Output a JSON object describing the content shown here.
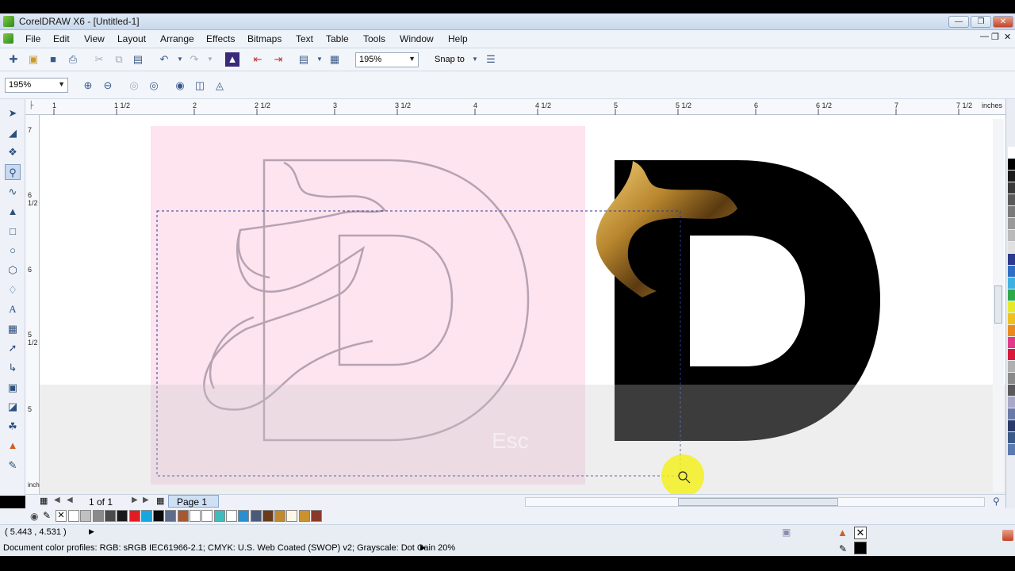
{
  "window": {
    "title": "CorelDRAW X6 - [Untitled-1]"
  },
  "menu": [
    "File",
    "Edit",
    "View",
    "Layout",
    "Arrange",
    "Effects",
    "Bitmaps",
    "Text",
    "Table",
    "Tools",
    "Window",
    "Help"
  ],
  "toolbar": {
    "zoom_value": "195%",
    "snap_label": "Snap to"
  },
  "toolbar2": {
    "zoom_value": "195%"
  },
  "ruler": {
    "h_labels": [
      "1",
      "1 1/2",
      "2",
      "2 1/2",
      "3",
      "3 1/2",
      "4",
      "4 1/2",
      "5",
      "5 1/2",
      "6",
      "6 1/2",
      "7",
      "7 1/2",
      "inches"
    ],
    "v_labels": [
      "7",
      "6 1/2",
      "6",
      "5 1/2",
      "5",
      "inches"
    ]
  },
  "pagebar": {
    "page_count": "1 of 1",
    "page_tab": "Page 1"
  },
  "status": {
    "coords": "( 5.443 , 4.531 )",
    "color_profile": "Document color profiles: RGB: sRGB IEC61966-2.1; CMYK: U.S. Web Coated (SWOP) v2; Grayscale: Dot Gain 20%"
  },
  "canvas": {
    "watermark_key": "Esc"
  },
  "colors": {
    "accent": "#3b5a88",
    "pink_bg": "#fde4ef",
    "outline": "#b7a2b1",
    "logo_fill": "#000000",
    "gold": "#b8862e"
  },
  "doc_palette": [
    "#ffffff",
    "#c0c0c0",
    "#8a8a8a",
    "#4a4a4a",
    "#1a1a1a",
    "#e21c24",
    "#19a6e0",
    "#0a0a0a",
    "#5f6c88",
    "#a8582e",
    "#ffffff",
    "#ffffff",
    "#3fbcc0",
    "#ffffff",
    "#2a8fd2",
    "#4a5a78",
    "#6a3a1a",
    "#c08a2c",
    "#fff7e8",
    "#c9922c",
    "#8a3a2a"
  ],
  "side_palette": [
    "#ffffff",
    "#000000",
    "#1a1a1a",
    "#3a3a3a",
    "#5a5a5a",
    "#7a7a7a",
    "#9a9a9a",
    "#bababa",
    "#e0e0e0",
    "#2b3a8c",
    "#2f6fc4",
    "#3fb0e0",
    "#2fa84a",
    "#e8e82a",
    "#f0c020",
    "#e88a20",
    "#e23a8a",
    "#d81a3a",
    "#b0b0b0",
    "#8a8a8a",
    "#5a5a5a",
    "#a8a8c8",
    "#6a7aa8",
    "#2a3a6a",
    "#3a5a8a",
    "#5a7ab0"
  ]
}
